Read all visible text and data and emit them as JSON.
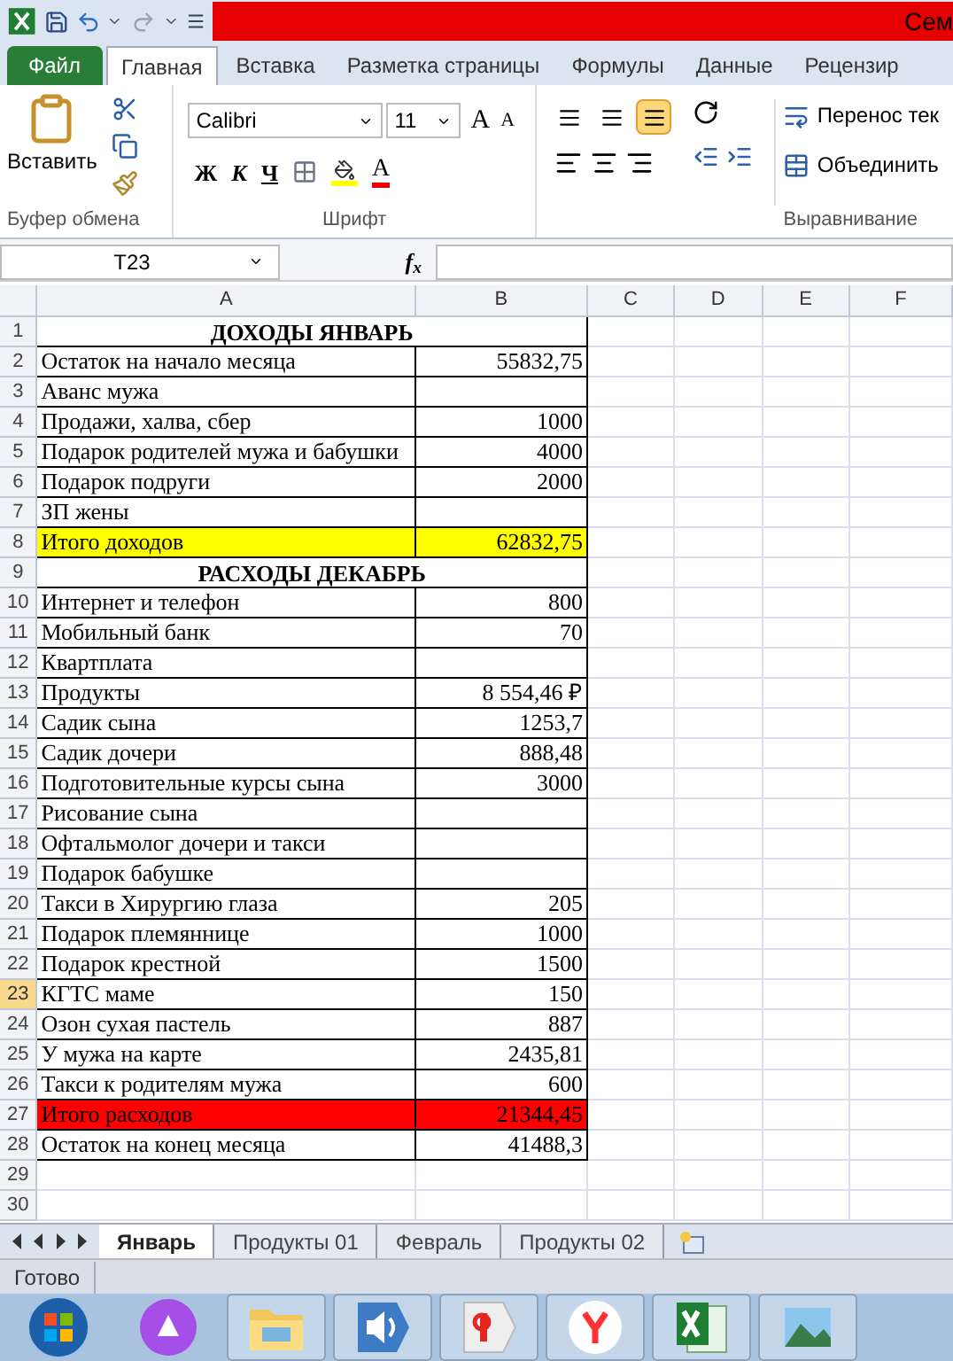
{
  "title_bar": {
    "title": "Сем"
  },
  "ribbon_tabs": [
    {
      "label": "Файл",
      "kind": "file",
      "selected": false
    },
    {
      "label": "Главная",
      "kind": "tab",
      "selected": true
    },
    {
      "label": "Вставка",
      "kind": "tab",
      "selected": false
    },
    {
      "label": "Разметка страницы",
      "kind": "tab",
      "selected": false
    },
    {
      "label": "Формулы",
      "kind": "tab",
      "selected": false
    },
    {
      "label": "Данные",
      "kind": "tab",
      "selected": false
    },
    {
      "label": "Рецензир",
      "kind": "tab",
      "selected": false
    }
  ],
  "ribbon": {
    "paste": "Вставить",
    "font_name": "Calibri",
    "font_size": "11",
    "grow_font": "A",
    "shrink_font": "A",
    "font_color": "A",
    "bold": "Ж",
    "italic": "К",
    "underline": "Ч",
    "wrap_text": "Перенос тек",
    "merge": "Объединить",
    "vertical_align": [
      {
        "selected": false
      },
      {
        "selected": false
      },
      {
        "selected": true
      }
    ],
    "groups": [
      "Буфер обмена",
      "Шрифт",
      "Выравнивание"
    ]
  },
  "formula_bar": {
    "name_box": "T23",
    "fx": "f$_{x}$"
  },
  "columns": [
    "A",
    "B",
    "C",
    "D",
    "E",
    "F"
  ],
  "rows": [
    {
      "number": "1",
      "kind": "heading",
      "label": "ДОХОДЫ ЯНВАРЬ",
      "selected": false
    },
    {
      "number": "2",
      "kind": "item",
      "label": "Остаток на начало месяца",
      "value": "55832,75",
      "selected": false
    },
    {
      "number": "3",
      "kind": "item",
      "label": "Аванс мужа",
      "selected": false
    },
    {
      "number": "4",
      "kind": "item",
      "label": "Продажи, халва, сбер",
      "value": "1000",
      "selected": false
    },
    {
      "number": "5",
      "kind": "item",
      "label": "Подарок родителей мужа и бабушки",
      "value": "4000",
      "selected": false
    },
    {
      "number": "6",
      "kind": "item",
      "label": "Подарок подруги",
      "value": "2000",
      "selected": false
    },
    {
      "number": "7",
      "kind": "item",
      "label": "ЗП жены",
      "selected": false
    },
    {
      "number": "8",
      "kind": "item",
      "label": "Итого доходов",
      "value": "62832,75",
      "color": "#ffff00",
      "selected": false
    },
    {
      "number": "9",
      "kind": "heading",
      "label": "РАСХОДЫ ДЕКАБРЬ",
      "selected": false
    },
    {
      "number": "10",
      "kind": "item",
      "label": "Интернет и телефон",
      "value": "800",
      "selected": false
    },
    {
      "number": "11",
      "kind": "item",
      "label": "Мобильный банк",
      "value": "70",
      "selected": false
    },
    {
      "number": "12",
      "kind": "item",
      "label": "Квартплата",
      "selected": false
    },
    {
      "number": "13",
      "kind": "item",
      "label": "Продукты",
      "value": "8 554,46 ₽",
      "selected": false
    },
    {
      "number": "14",
      "kind": "item",
      "label": "Садик сына",
      "value": "1253,7",
      "selected": false
    },
    {
      "number": "15",
      "kind": "item",
      "label": "Садик дочери",
      "value": "888,48",
      "selected": false
    },
    {
      "number": "16",
      "kind": "item",
      "label": "Подготовительные курсы сына",
      "value": "3000",
      "selected": false
    },
    {
      "number": "17",
      "kind": "item",
      "label": "Рисование сына",
      "selected": false
    },
    {
      "number": "18",
      "kind": "item",
      "label": "Офтальмолог дочери и такси",
      "selected": false
    },
    {
      "number": "19",
      "kind": "item",
      "label": "Подарок бабушке",
      "selected": false
    },
    {
      "number": "20",
      "kind": "item",
      "label": "Такси в Хирургию глаза",
      "value": "205",
      "selected": false
    },
    {
      "number": "21",
      "kind": "item",
      "label": "Подарок племяннице",
      "value": "1000",
      "selected": false
    },
    {
      "number": "22",
      "kind": "item",
      "label": "Подарок крестной",
      "value": "1500",
      "selected": false
    },
    {
      "number": "23",
      "kind": "item",
      "label": "КГТС маме",
      "value": "150",
      "selected": true
    },
    {
      "number": "24",
      "kind": "item",
      "label": "Озон сухая пастель",
      "value": "887",
      "selected": false
    },
    {
      "number": "25",
      "kind": "item",
      "label": "У мужа на карте",
      "value": "2435,81",
      "selected": false
    },
    {
      "number": "26",
      "kind": "item",
      "label": "Такси к родителям мужа",
      "value": "600",
      "selected": false
    },
    {
      "number": "27",
      "kind": "item",
      "label": "Итого расходов",
      "value": "21344,45",
      "color": "#ff0000",
      "selected": false
    },
    {
      "number": "28",
      "kind": "item",
      "label": "Остаток на конец месяца",
      "value": "41488,3",
      "selected": false
    },
    {
      "number": "29",
      "kind": "empty",
      "selected": false
    },
    {
      "number": "30",
      "kind": "empty",
      "selected": false
    }
  ],
  "sheet_tabs": [
    {
      "label": "Январь",
      "selected": true
    },
    {
      "label": "Продукты 01",
      "selected": false
    },
    {
      "label": "Февраль",
      "selected": false
    },
    {
      "label": "Продукты 02",
      "selected": false
    }
  ],
  "status_bar": {
    "text": "Готово"
  },
  "taskbar": [
    {
      "kind": "start"
    },
    {
      "kind": "alice"
    },
    {
      "kind": "folder"
    },
    {
      "kind": "speaker"
    },
    {
      "kind": "yandex"
    },
    {
      "kind": "browser"
    },
    {
      "kind": "excel"
    },
    {
      "kind": "photos"
    }
  ]
}
